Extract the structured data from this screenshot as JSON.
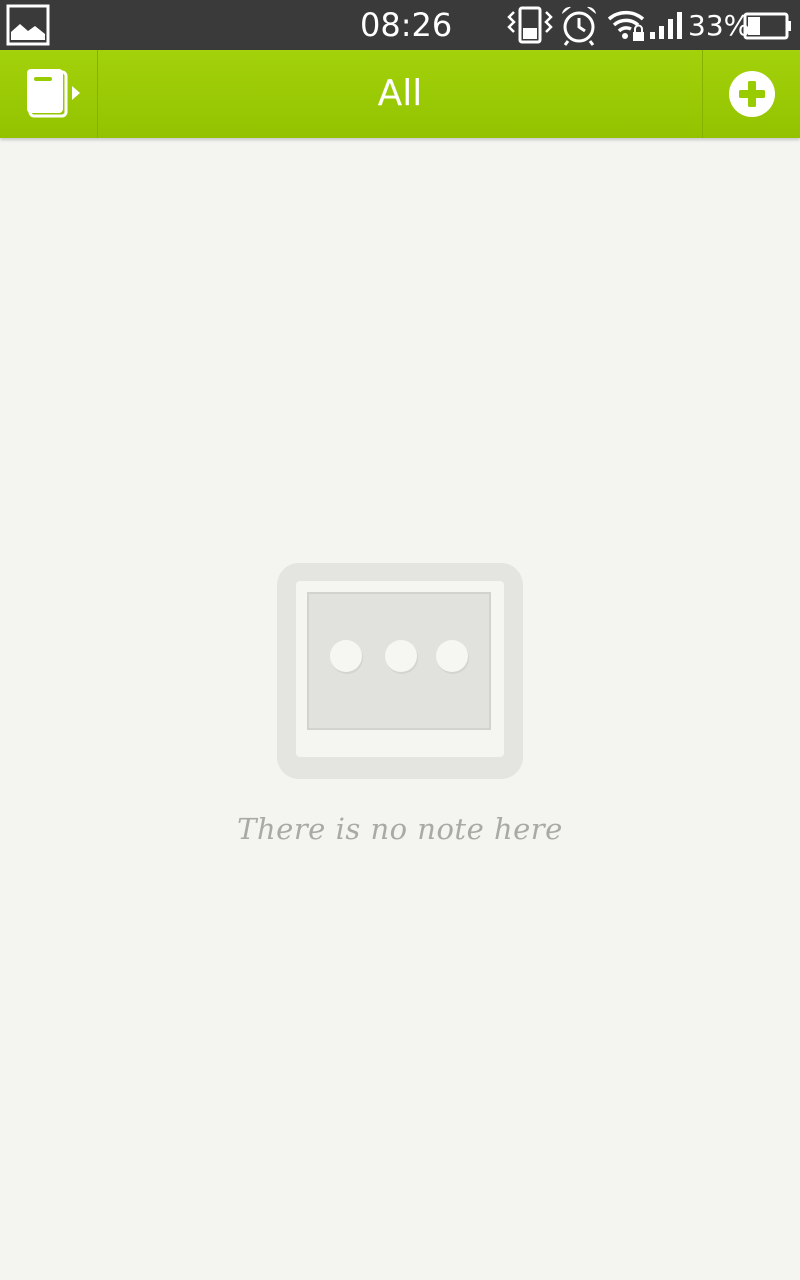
{
  "status_bar": {
    "time": "08:26",
    "battery_percent": "33%",
    "battery_level": 0.33,
    "icons": [
      "image-notification-icon",
      "vibrate-icon",
      "alarm-icon",
      "wifi-lock-icon",
      "signal-icon",
      "battery-icon"
    ]
  },
  "app_bar": {
    "title": "All",
    "left_icon": "notebook-icon",
    "right_icon": "add-circle-icon",
    "accent_color": "#99cc00"
  },
  "empty_state": {
    "message": "There is no note here",
    "icon": "empty-note-icon"
  }
}
